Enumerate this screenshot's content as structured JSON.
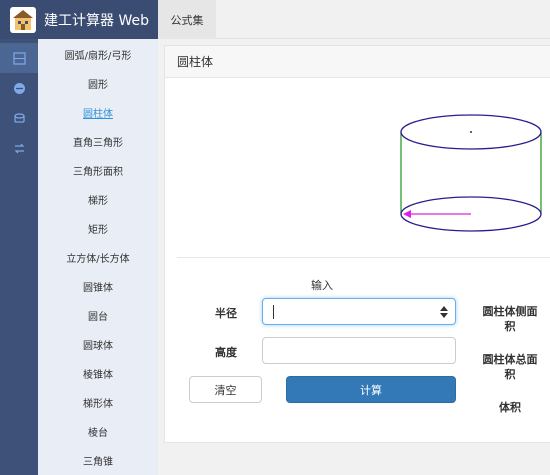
{
  "app": {
    "title": "建工计算器 Web",
    "logo_icon": "house-logo-icon"
  },
  "topbar": {
    "tab_label": "公式集"
  },
  "rail": {
    "items": [
      {
        "icon": "formula-icon",
        "active": true
      },
      {
        "icon": "unit-convert-icon",
        "active": false
      },
      {
        "icon": "material-icon",
        "active": false
      },
      {
        "icon": "exchange-icon",
        "active": false
      }
    ]
  },
  "submenu": {
    "items": [
      {
        "label": "圆弧/扇形/弓形",
        "active": false
      },
      {
        "label": "圆形",
        "active": false
      },
      {
        "label": "圆柱体",
        "active": true
      },
      {
        "label": "直角三角形",
        "active": false
      },
      {
        "label": "三角形面积",
        "active": false
      },
      {
        "label": "梯形",
        "active": false
      },
      {
        "label": "矩形",
        "active": false
      },
      {
        "label": "立方体/长方体",
        "active": false
      },
      {
        "label": "圆锥体",
        "active": false
      },
      {
        "label": "圆台",
        "active": false
      },
      {
        "label": "圆球体",
        "active": false
      },
      {
        "label": "棱锥体",
        "active": false
      },
      {
        "label": "梯形体",
        "active": false
      },
      {
        "label": "棱台",
        "active": false
      },
      {
        "label": "三角锥",
        "active": false
      }
    ]
  },
  "panel": {
    "title": "圆柱体",
    "form_caption": "输入",
    "radius_label": "半径",
    "radius_value": "",
    "height_label": "高度",
    "height_value": "",
    "clear_label": "清空",
    "calc_label": "计算",
    "results": [
      "圆柱体侧面积",
      "圆柱体总面积",
      "体积"
    ]
  },
  "colors": {
    "header_bg": "#3a4c72",
    "rail_bg": "#3e5178",
    "submenu_bg": "#e9edf6",
    "active_link": "#2f93d8",
    "primary_button": "#3379b7",
    "cylinder_ellipse": "#2b1b8f",
    "cylinder_side": "#2e9b2e",
    "radius_arrow": "#e020e0"
  }
}
